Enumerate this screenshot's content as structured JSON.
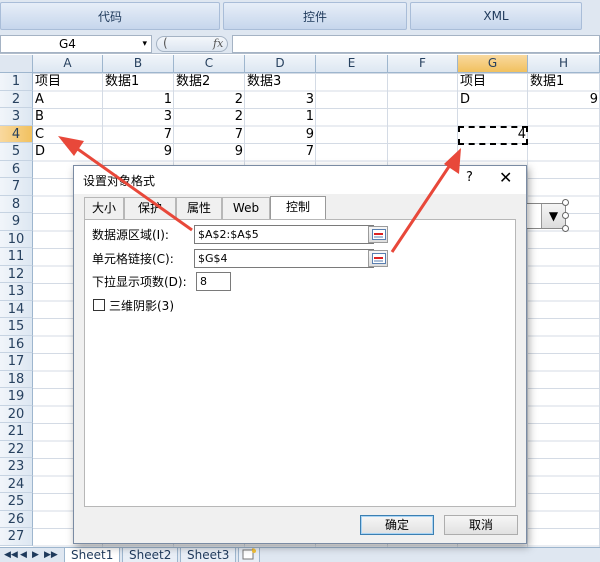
{
  "ribbon": {
    "tabs": [
      "代码",
      "控件",
      "XML"
    ]
  },
  "formula_bar": {
    "name_box": "G4",
    "name_box_arrow": "▾",
    "cancel_mark": "✓",
    "fx": "fx",
    "formula": ""
  },
  "sheet": {
    "columns": [
      "A",
      "B",
      "C",
      "D",
      "E",
      "F",
      "G",
      "H"
    ],
    "rows": [
      "1",
      "2",
      "3",
      "4",
      "5",
      "6",
      "7",
      "8",
      "9",
      "10",
      "11",
      "12",
      "13",
      "14",
      "15",
      "16",
      "17",
      "18",
      "19",
      "20",
      "21",
      "22",
      "23",
      "24",
      "25",
      "26",
      "27"
    ],
    "selected_column": "G",
    "selected_row": "4",
    "cells": {
      "A1": "项目",
      "B1": "数据1",
      "C1": "数据2",
      "D1": "数据3",
      "A2": "A",
      "B2": "1",
      "C2": "2",
      "D2": "3",
      "A3": "B",
      "B3": "3",
      "C3": "2",
      "D3": "1",
      "A4": "C",
      "B4": "7",
      "C4": "7",
      "D4": "9",
      "A5": "D",
      "B5": "9",
      "C5": "9",
      "D5": "7",
      "G1": "项目",
      "H1": "数据1",
      "G2": "D",
      "H2": "9",
      "G4": "4"
    },
    "combo_arrow": "▼"
  },
  "sheet_tabs": {
    "nav": [
      "◀◀",
      "◀",
      "▶",
      "▶▶"
    ],
    "tabs": [
      "Sheet1",
      "Sheet2",
      "Sheet3"
    ],
    "active": "Sheet1"
  },
  "dialog": {
    "title": "设置对象格式",
    "help": "?",
    "close": "✕",
    "tabs": [
      "大小",
      "保护",
      "属性",
      "Web",
      "控制"
    ],
    "active_tab": "控制",
    "fields": {
      "source_range_label": "数据源区域(I):",
      "source_range_value": "$A$2:$A$5",
      "cell_link_label": "单元格链接(C):",
      "cell_link_value": "$G$4",
      "dropdown_lines_label": "下拉显示项数(D):",
      "dropdown_lines_value": "8",
      "shading_label": "三维阴影(3)"
    },
    "ok_label": "确定",
    "cancel_label": "取消"
  },
  "colors": {
    "arrow": "#e8483a",
    "ribbon_text": "#1e395b",
    "header_selected": "#f1c15f"
  }
}
